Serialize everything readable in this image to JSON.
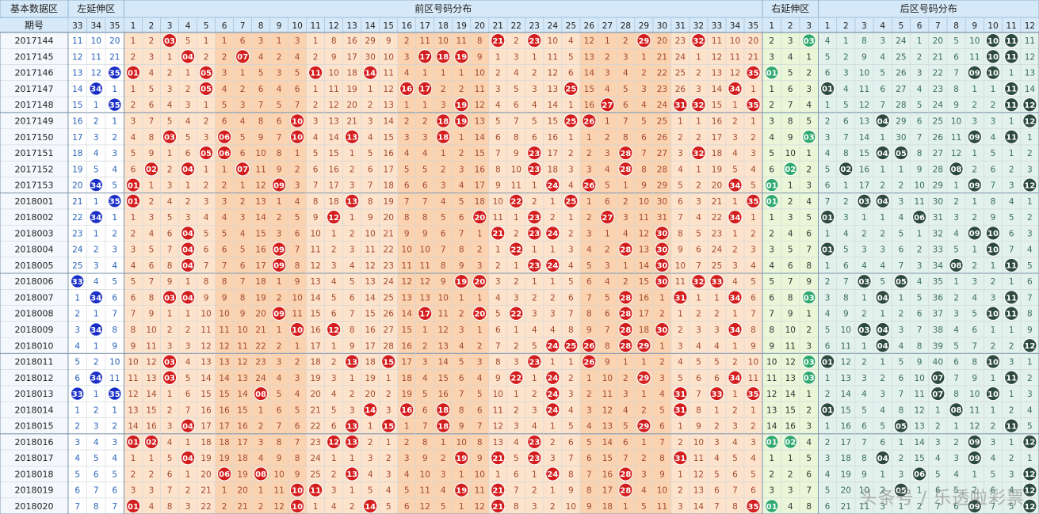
{
  "chart_data": {
    "type": "table",
    "headers": {
      "basic": "基本数据区",
      "left_ext": "左延伸区",
      "front": "前区号码分布",
      "right_ext": "右延伸区",
      "back": "后区号码分布",
      "period_label": "期号"
    },
    "left_ext_columns": [
      "33",
      "34",
      "35"
    ],
    "right_ext_columns": [
      "1",
      "2",
      "3"
    ],
    "front_columns": [
      "1",
      "2",
      "3",
      "4",
      "5",
      "6",
      "7",
      "8",
      "9",
      "10",
      "11",
      "12",
      "13",
      "14",
      "15",
      "16",
      "17",
      "18",
      "19",
      "20",
      "21",
      "22",
      "23",
      "24",
      "25",
      "26",
      "27",
      "28",
      "29",
      "30",
      "31",
      "32",
      "33",
      "34",
      "35"
    ],
    "back_columns": [
      "1",
      "2",
      "3",
      "4",
      "5",
      "6",
      "7",
      "8",
      "9",
      "10",
      "11",
      "12"
    ],
    "rows": [
      {
        "period": "2017144",
        "front_hits": [
          3,
          21,
          23,
          29,
          32
        ],
        "back_hits": [
          10,
          11
        ],
        "left": [
          "11",
          "10",
          "20"
        ],
        "right": [
          "2",
          "3",
          "03"
        ]
      },
      {
        "period": "2017145",
        "front_hits": [
          4,
          7,
          17,
          18,
          19
        ],
        "back_hits": [
          10,
          11
        ],
        "left": [
          "12",
          "11",
          "21"
        ],
        "right": [
          "3",
          "4",
          "1"
        ]
      },
      {
        "period": "2017146",
        "front_hits": [
          1,
          5,
          11,
          14,
          35
        ],
        "back_hits": [
          9,
          10
        ],
        "left": [
          "13",
          "12",
          "35"
        ],
        "right": [
          "01",
          "5",
          "2"
        ]
      },
      {
        "period": "2017147",
        "front_hits": [
          5,
          16,
          17,
          25,
          34
        ],
        "back_hits": [
          1,
          11
        ],
        "left": [
          "14",
          "34",
          "1"
        ],
        "right": [
          "1",
          "6",
          "3"
        ]
      },
      {
        "period": "2017148",
        "front_hits": [
          19,
          27,
          31,
          32,
          35
        ],
        "back_hits": [
          11,
          12
        ],
        "left": [
          "15",
          "1",
          "35"
        ],
        "right": [
          "2",
          "7",
          "4"
        ]
      },
      {
        "period": "2017149",
        "front_hits": [
          10,
          18,
          19,
          25,
          26
        ],
        "back_hits": [
          4,
          12
        ],
        "left": [
          "16",
          "2",
          "1"
        ],
        "right": [
          "3",
          "8",
          "5"
        ]
      },
      {
        "period": "2017150",
        "front_hits": [
          3,
          6,
          10,
          13,
          18
        ],
        "back_hits": [
          9,
          11
        ],
        "left": [
          "17",
          "3",
          "2"
        ],
        "right": [
          "4",
          "9",
          "03"
        ]
      },
      {
        "period": "2017151",
        "front_hits": [
          5,
          6,
          23,
          28,
          32
        ],
        "back_hits": [
          4,
          5
        ],
        "left": [
          "18",
          "4",
          "3"
        ],
        "right": [
          "5",
          "10",
          "1"
        ]
      },
      {
        "period": "2017152",
        "front_hits": [
          2,
          4,
          7,
          23,
          28
        ],
        "back_hits": [
          2,
          8
        ],
        "left": [
          "19",
          "5",
          "4"
        ],
        "right": [
          "6",
          "02",
          "2"
        ]
      },
      {
        "period": "2017153",
        "front_hits": [
          1,
          9,
          24,
          26,
          34
        ],
        "back_hits": [
          9,
          12
        ],
        "left": [
          "20",
          "34",
          "5"
        ],
        "right": [
          "01",
          "1",
          "3"
        ]
      },
      {
        "period": "2018001",
        "front_hits": [
          1,
          13,
          22,
          25,
          35
        ],
        "back_hits": [
          3,
          4
        ],
        "left": [
          "21",
          "1",
          "35"
        ],
        "right": [
          "01",
          "2",
          "4"
        ]
      },
      {
        "period": "2018002",
        "front_hits": [
          12,
          20,
          23,
          27,
          34
        ],
        "back_hits": [
          1,
          6
        ],
        "left": [
          "22",
          "34",
          "1"
        ],
        "right": [
          "1",
          "3",
          "5"
        ]
      },
      {
        "period": "2018003",
        "front_hits": [
          4,
          21,
          23,
          24,
          30
        ],
        "back_hits": [
          9,
          10
        ],
        "left": [
          "23",
          "1",
          "2"
        ],
        "right": [
          "2",
          "4",
          "6"
        ]
      },
      {
        "period": "2018004",
        "front_hits": [
          4,
          9,
          22,
          28,
          30
        ],
        "back_hits": [
          1,
          10
        ],
        "left": [
          "24",
          "2",
          "3"
        ],
        "right": [
          "3",
          "5",
          "7"
        ]
      },
      {
        "period": "2018005",
        "front_hits": [
          4,
          9,
          23,
          24,
          30
        ],
        "back_hits": [
          8,
          11
        ],
        "left": [
          "25",
          "3",
          "4"
        ],
        "right": [
          "4",
          "6",
          "8"
        ]
      },
      {
        "period": "2018006",
        "front_hits": [
          19,
          20,
          30,
          32,
          33
        ],
        "back_hits": [
          3,
          5
        ],
        "left": [
          "33",
          "4",
          "5"
        ],
        "right": [
          "5",
          "7",
          "9"
        ]
      },
      {
        "period": "2018007",
        "front_hits": [
          3,
          4,
          28,
          31,
          34
        ],
        "back_hits": [
          4,
          11
        ],
        "left": [
          "1",
          "34",
          "6"
        ],
        "right": [
          "6",
          "8",
          "03"
        ]
      },
      {
        "period": "2018008",
        "front_hits": [
          9,
          17,
          20,
          22,
          28
        ],
        "back_hits": [
          10,
          11
        ],
        "left": [
          "2",
          "1",
          "7"
        ],
        "right": [
          "7",
          "9",
          "1"
        ]
      },
      {
        "period": "2018009",
        "front_hits": [
          10,
          12,
          28,
          30,
          34
        ],
        "back_hits": [
          3,
          4
        ],
        "left": [
          "3",
          "34",
          "8"
        ],
        "right": [
          "8",
          "10",
          "2"
        ]
      },
      {
        "period": "2018010",
        "front_hits": [
          24,
          25,
          26,
          28,
          29
        ],
        "back_hits": [
          4,
          12
        ],
        "left": [
          "4",
          "1",
          "9"
        ],
        "right": [
          "9",
          "11",
          "3"
        ]
      },
      {
        "period": "2018011",
        "front_hits": [
          3,
          13,
          15,
          23,
          26
        ],
        "back_hits": [
          1,
          10
        ],
        "left": [
          "5",
          "2",
          "10"
        ],
        "right": [
          "10",
          "12",
          "03"
        ]
      },
      {
        "period": "2018012",
        "front_hits": [
          3,
          22,
          24,
          29,
          34
        ],
        "back_hits": [
          7,
          11
        ],
        "left": [
          "6",
          "34",
          "11"
        ],
        "right": [
          "11",
          "13",
          "03"
        ]
      },
      {
        "period": "2018013",
        "front_hits": [
          8,
          24,
          31,
          33,
          35
        ],
        "back_hits": [
          7,
          10
        ],
        "left": [
          "33",
          "1",
          "35"
        ],
        "right": [
          "12",
          "14",
          "1"
        ]
      },
      {
        "period": "2018014",
        "front_hits": [
          14,
          16,
          18,
          24,
          31
        ],
        "back_hits": [
          1,
          8
        ],
        "left": [
          "1",
          "2",
          "1"
        ],
        "right": [
          "13",
          "15",
          "2"
        ]
      },
      {
        "period": "2018015",
        "front_hits": [
          4,
          13,
          15,
          18,
          29
        ],
        "back_hits": [
          5,
          11
        ],
        "left": [
          "2",
          "3",
          "2"
        ],
        "right": [
          "14",
          "16",
          "3"
        ]
      },
      {
        "period": "2018016",
        "front_hits": [
          1,
          2,
          12,
          13,
          23
        ],
        "back_hits": [
          9,
          12
        ],
        "left": [
          "3",
          "4",
          "3"
        ],
        "right": [
          "01",
          "02",
          "4"
        ]
      },
      {
        "period": "2018017",
        "front_hits": [
          4,
          19,
          21,
          23,
          31
        ],
        "back_hits": [
          4,
          9
        ],
        "left": [
          "4",
          "5",
          "4"
        ],
        "right": [
          "1",
          "1",
          "5"
        ]
      },
      {
        "period": "2018018",
        "front_hits": [
          6,
          8,
          13,
          24,
          28
        ],
        "back_hits": [
          6,
          12
        ],
        "left": [
          "5",
          "6",
          "5"
        ],
        "right": [
          "2",
          "2",
          "6"
        ]
      },
      {
        "period": "2018019",
        "front_hits": [
          10,
          11,
          19,
          21,
          28
        ],
        "back_hits": [
          5,
          12
        ],
        "left": [
          "6",
          "7",
          "6"
        ],
        "right": [
          "3",
          "3",
          "7"
        ]
      },
      {
        "period": "2018020",
        "front_hits": [
          1,
          10,
          14,
          21,
          35
        ],
        "back_hits": [
          9,
          12
        ],
        "left": [
          "7",
          "8",
          "7"
        ],
        "right": [
          "01",
          "4",
          "8"
        ]
      }
    ]
  },
  "watermark": "头条号 / 乐透啦彩票",
  "colors": {
    "front_ball": "#d41d1d",
    "back_ball": "#2d4a3e",
    "left_ball": "#1a2fc8",
    "right_ball": "#2ea86f",
    "front_bg_a": "#fde3cc",
    "front_bg_b": "#fbd3b0",
    "right_bg": "#eaf6d8",
    "back_bg": "#e2f1ec",
    "header_bg": "#d6e9f8",
    "front_text": "#a24a2c",
    "back_text": "#3a6d5d"
  }
}
